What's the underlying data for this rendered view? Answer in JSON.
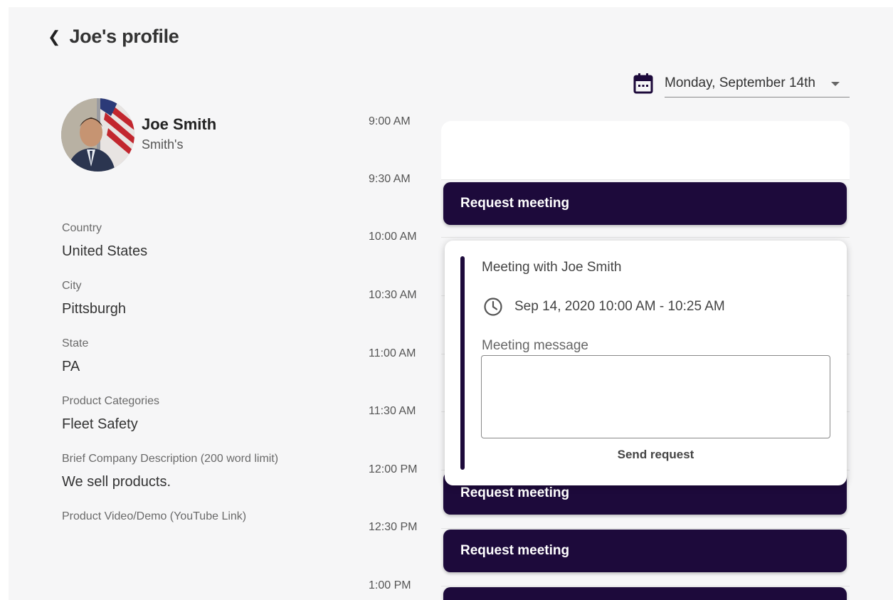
{
  "header": {
    "back_icon": "chevron-left-icon",
    "title": "Joe's profile"
  },
  "date_picker": {
    "icon": "calendar-icon",
    "selected": "Monday, September 14th"
  },
  "profile": {
    "name": "Joe Smith",
    "company": "Smith's",
    "fields": [
      {
        "label": "Country",
        "value": "United States"
      },
      {
        "label": "City",
        "value": "Pittsburgh"
      },
      {
        "label": "State",
        "value": "PA"
      },
      {
        "label": "Product Categories",
        "value": "Fleet Safety"
      },
      {
        "label": "Brief Company Description (200 word limit)",
        "value": "We sell products."
      },
      {
        "label": "Product Video/Demo (YouTube Link)",
        "value": ""
      }
    ]
  },
  "schedule": {
    "times": [
      "9:00 AM",
      "9:30 AM",
      "10:00 AM",
      "10:30 AM",
      "11:00 AM",
      "11:30 AM",
      "12:00 PM",
      "12:30 PM",
      "1:00 PM"
    ],
    "request_label": "Request meeting"
  },
  "popup": {
    "title": "Meeting with Joe Smith",
    "clock_icon": "clock-icon",
    "time_range": "Sep 14, 2020 10:00 AM - 10:25 AM",
    "message_label": "Meeting message",
    "message_value": "",
    "send_label": "Send request"
  },
  "colors": {
    "primary": "#1d0a3b",
    "background": "#f6f6f7"
  }
}
